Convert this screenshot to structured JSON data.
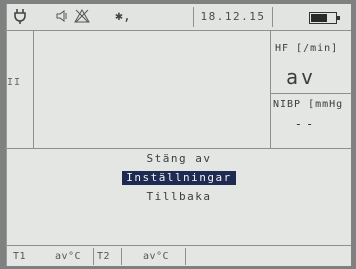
{
  "status_bar": {
    "date": "18.12.15",
    "battery_level": 0.65,
    "icons": [
      "plug-icon",
      "speaker-muted-icon",
      "alarm-off-icon",
      "bluetooth-icon",
      "battery-icon"
    ]
  },
  "waveform": {
    "lead_label": "II"
  },
  "vitals": {
    "hf_label": "HF [/min]",
    "hf_value": "av",
    "nibp_label": "NIBP [mmHg",
    "nibp_value": "--"
  },
  "menu": {
    "items": [
      {
        "label": "Stäng av",
        "selected": false
      },
      {
        "label": "Inställningar",
        "selected": true
      },
      {
        "label": "Tillbaka",
        "selected": false
      }
    ]
  },
  "temps": {
    "t1_label": "T1",
    "t1_value": "av°C",
    "t2_label": "T2",
    "t2_value": "av°C"
  }
}
